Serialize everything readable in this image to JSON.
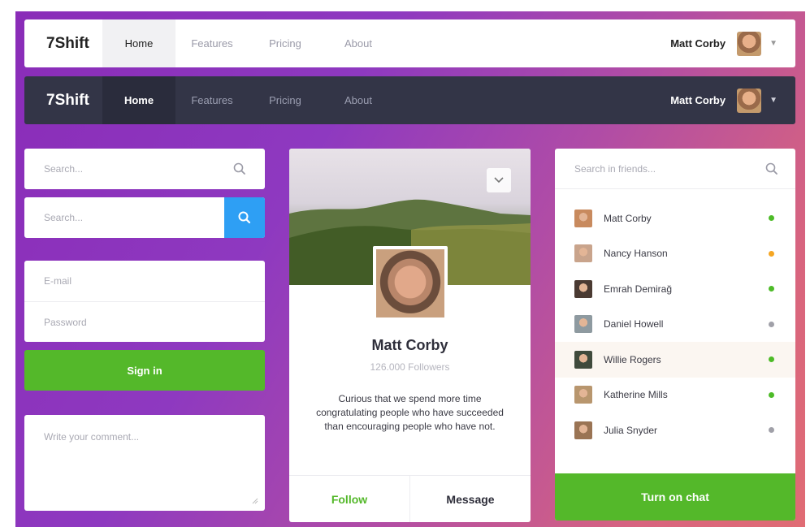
{
  "colors": {
    "accent_green": "#54b82a",
    "accent_blue": "#2e9ff4",
    "status_online": "#4dbb28",
    "status_away": "#f5a623",
    "status_offline": "#a0a0a8"
  },
  "navbar_light": {
    "brand": "7Shift",
    "links": [
      {
        "label": "Home",
        "active": true
      },
      {
        "label": "Features",
        "active": false
      },
      {
        "label": "Pricing",
        "active": false
      },
      {
        "label": "About",
        "active": false
      }
    ],
    "user_name": "Matt Corby",
    "caret_icon": "chevron-down-icon"
  },
  "navbar_dark": {
    "brand": "7Shift",
    "links": [
      {
        "label": "Home",
        "active": true
      },
      {
        "label": "Features",
        "active": false
      },
      {
        "label": "Pricing",
        "active": false
      },
      {
        "label": "About",
        "active": false
      }
    ],
    "user_name": "Matt Corby",
    "caret_icon": "chevron-down-icon"
  },
  "left_column": {
    "search_plain": {
      "placeholder": "Search...",
      "icon": "search-icon"
    },
    "search_button": {
      "placeholder": "Search...",
      "icon": "search-icon"
    },
    "login": {
      "email_placeholder": "E-mail",
      "password_placeholder": "Password"
    },
    "signin_label": "Sign in",
    "comment_placeholder": "Write your comment..."
  },
  "profile_card": {
    "name": "Matt Corby",
    "followers": "126.000 Followers",
    "bio": "Curious that we spend more time congratulating people who have succeeded than encouraging people who have not.",
    "follow_label": "Follow",
    "message_label": "Message",
    "menu_icon": "chevron-down-icon"
  },
  "friends_panel": {
    "search_placeholder": "Search in friends...",
    "friends": [
      {
        "name": "Matt Corby",
        "status": "online",
        "avatar_color": "#c88a5e"
      },
      {
        "name": "Nancy Hanson",
        "status": "away",
        "avatar_color": "#c9a48c"
      },
      {
        "name": "Emrah Demirağ",
        "status": "online",
        "avatar_color": "#4a3a32"
      },
      {
        "name": "Daniel Howell",
        "status": "offline",
        "avatar_color": "#8e9aa0"
      },
      {
        "name": "Willie Rogers",
        "status": "online",
        "avatar_color": "#3f4a3c",
        "highlighted": true
      },
      {
        "name": "Katherine Mills",
        "status": "online",
        "avatar_color": "#b8966e"
      },
      {
        "name": "Julia Snyder",
        "status": "offline",
        "avatar_color": "#9a7454"
      }
    ],
    "chat_label": "Turn on chat"
  }
}
